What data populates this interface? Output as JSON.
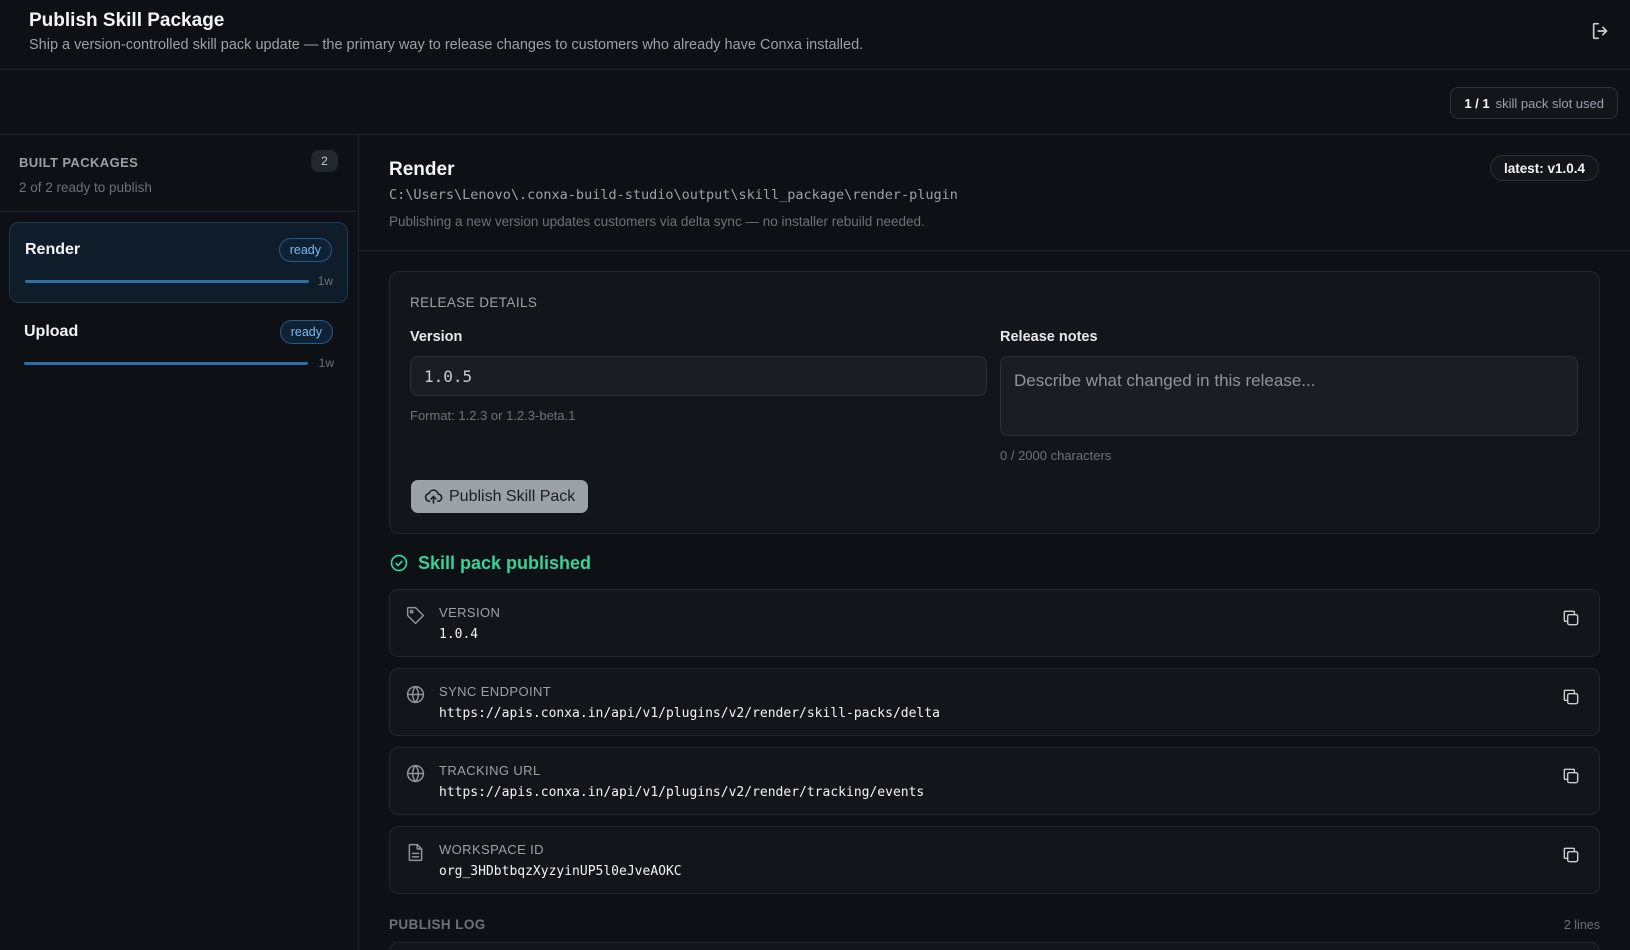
{
  "header": {
    "title": "Publish Skill Package",
    "subtitle": "Ship a version-controlled skill pack update — the primary way to release changes to customers who already have Conxa installed.",
    "exit_icon": "logout-icon"
  },
  "toolbar": {
    "slot_count": "1 / 1",
    "slot_label": "skill pack slot used"
  },
  "sidebar": {
    "title": "BUILT PACKAGES",
    "count": "2",
    "summary": "2 of 2 ready to publish",
    "packages": [
      {
        "name": "Render",
        "status": "ready",
        "age": "1w",
        "progress": 1.0
      },
      {
        "name": "Upload",
        "status": "ready",
        "age": "1w",
        "progress": 1.0
      }
    ]
  },
  "plugin": {
    "name": "Render",
    "path": "C:\\Users\\Lenovo\\.conxa-build-studio\\output\\skill_package\\render-plugin",
    "note": "Publishing a new version updates customers via delta sync — no installer rebuild needed.",
    "latest": "latest: v1.0.4"
  },
  "release": {
    "section_title": "RELEASE DETAILS",
    "version_label": "Version",
    "version_value": "1.0.5",
    "version_hint": "Format: 1.2.3 or 1.2.3-beta.1",
    "notes_label": "Release notes",
    "notes_placeholder": "Describe what changed in this release...",
    "notes_counter": "0 / 2000 characters",
    "publish_label": "Publish Skill Pack"
  },
  "result": {
    "status_text": "Skill pack published",
    "status_color": "#35d39a",
    "fields": [
      {
        "key": "VERSION",
        "value": "1.0.4",
        "icon": "tag-icon"
      },
      {
        "key": "SYNC ENDPOINT",
        "value": "https://apis.conxa.in/api/v1/plugins/v2/render/skill-packs/delta",
        "icon": "globe-icon"
      },
      {
        "key": "TRACKING URL",
        "value": "https://apis.conxa.in/api/v1/plugins/v2/render/tracking/events",
        "icon": "globe-icon"
      },
      {
        "key": "WORKSPACE ID",
        "value": "org_3HDbtbqzXyzyinUP5l0eJveAOKC",
        "icon": "document-icon"
      }
    ]
  },
  "log": {
    "title": "PUBLISH LOG",
    "count": "2 lines"
  }
}
